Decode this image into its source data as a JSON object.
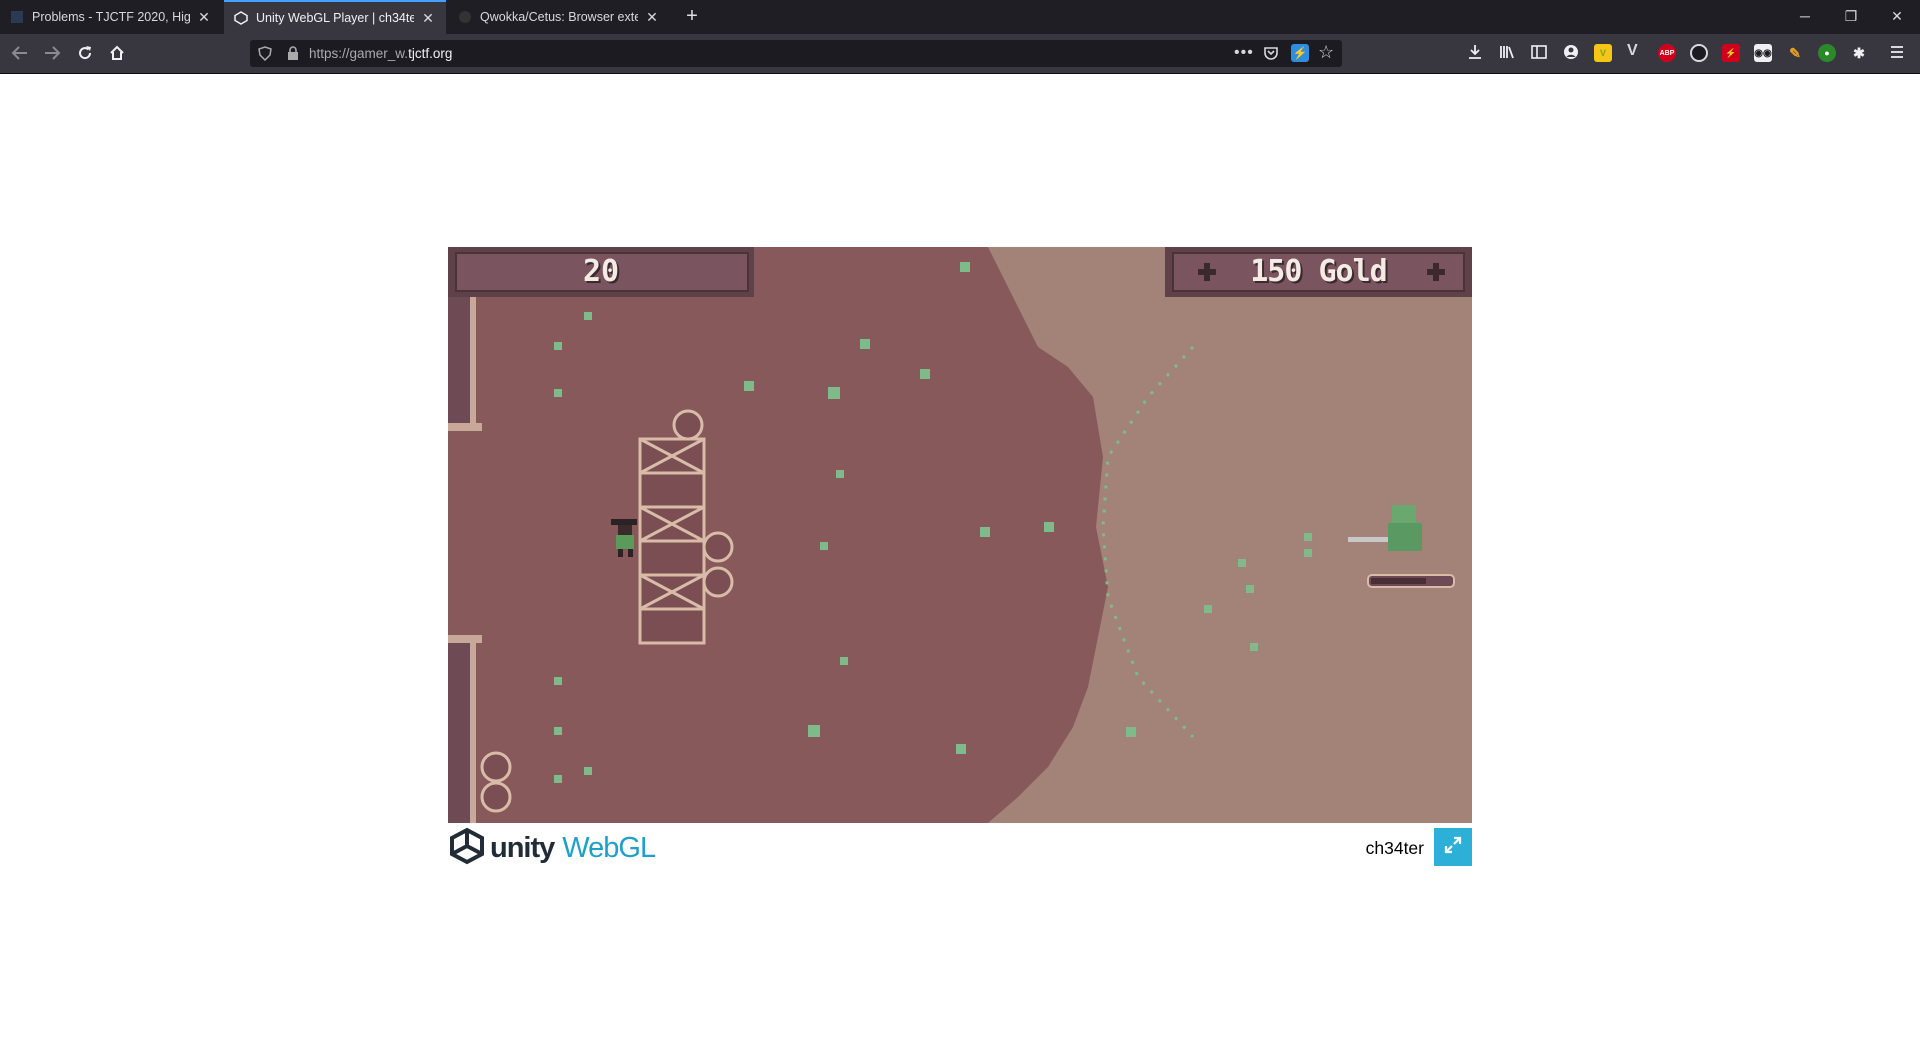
{
  "browser": {
    "tabs": [
      {
        "title": "Problems - TJCTF 2020, High Sc",
        "active": false
      },
      {
        "title": "Unity WebGL Player | ch34ter",
        "active": true
      },
      {
        "title": "Qwokka/Cetus: Browser extens",
        "active": false
      }
    ],
    "url_prefix": "https://gamer_w.",
    "url_domain": "tjctf.org",
    "extensions": [
      "downloads-icon",
      "library-icon",
      "sidebar-icon",
      "account-icon",
      "vimium-icon",
      "v-icon",
      "adblock-icon",
      "ext-dark-icon",
      "ext-red-icon",
      "ext-mask-icon",
      "ext-pencil-icon",
      "ext-green-icon",
      "ext-bug-icon"
    ],
    "abp_label": "ABP"
  },
  "game": {
    "wave": "20",
    "gold": "150 Gold",
    "colors": {
      "dark_ground": "#87595b",
      "sand": "#a38377",
      "hud": "#5e4149"
    }
  },
  "footer": {
    "unity": "unity",
    "webgl": "WebGL",
    "title": "ch34ter"
  }
}
